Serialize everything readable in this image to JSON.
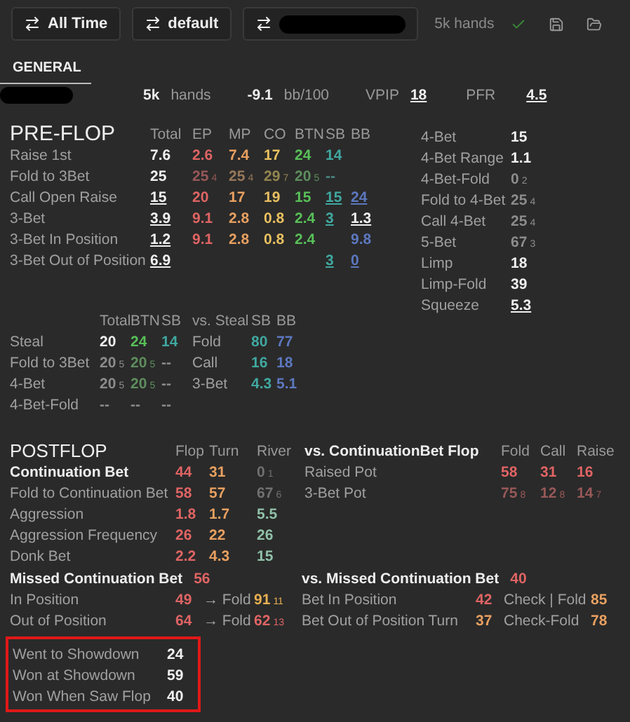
{
  "toolbar": {
    "buttons": [
      {
        "label": "All Time",
        "redacted": false
      },
      {
        "label": "default",
        "redacted": false
      },
      {
        "redacted": true
      }
    ],
    "hands": "5k hands"
  },
  "tabs": [
    {
      "label": "GENERAL",
      "selected": true
    }
  ],
  "summary": {
    "player_redacted": true,
    "items": [
      {
        "value": "5k",
        "unit": "hands"
      },
      {
        "value": "-9.1",
        "unit": "bb/100"
      },
      {
        "unit": "VPIP",
        "value": "18",
        "underlined": true
      },
      {
        "unit": "PFR",
        "value": "4.5",
        "underlined": true
      }
    ]
  },
  "preflop": {
    "title": "PRE-FLOP",
    "columns": [
      "Total",
      "EP",
      "MP",
      "CO",
      "BTN",
      "SB",
      "BB"
    ],
    "rows": [
      {
        "label": "Raise 1st",
        "cells": [
          {
            "v": "7.6",
            "color": "#f0f0f0"
          },
          {
            "v": "2.6",
            "color": "#e06464"
          },
          {
            "v": "7.4",
            "color": "#e8a060"
          },
          {
            "v": "17",
            "color": "#e8c060"
          },
          {
            "v": "24",
            "color": "#58c058"
          },
          {
            "v": "14",
            "color": "#40a8a0"
          },
          null
        ]
      },
      {
        "label": "Fold to 3Bet",
        "cells": [
          {
            "v": "25",
            "color": "#f0f0f0"
          },
          {
            "v": "25",
            "n": "4",
            "color": "#985858"
          },
          {
            "v": "25",
            "n": "4",
            "color": "#98785a"
          },
          {
            "v": "29",
            "n": "7",
            "color": "#948650"
          },
          {
            "v": "20",
            "n": "5",
            "color": "#5e8e5e"
          },
          {
            "v": "--",
            "color": "#4a8a84"
          },
          null
        ]
      },
      {
        "label": "Call Open Raise",
        "cells": [
          {
            "v": "15",
            "color": "#f0f0f0",
            "underlined": true
          },
          {
            "v": "20",
            "color": "#e06464"
          },
          {
            "v": "17",
            "color": "#e8a060"
          },
          {
            "v": "19",
            "color": "#e8c060"
          },
          {
            "v": "15",
            "color": "#58c058"
          },
          {
            "v": "15",
            "color": "#40a8a0",
            "underlined": true
          },
          {
            "v": "24",
            "color": "#5c78c0",
            "underlined": true
          }
        ]
      },
      {
        "label": "3-Bet",
        "cells": [
          {
            "v": "3.9",
            "color": "#f0f0f0",
            "underlined": true
          },
          {
            "v": "9.1",
            "color": "#e06464"
          },
          {
            "v": "2.8",
            "color": "#e8a060"
          },
          {
            "v": "0.8",
            "color": "#e8c060"
          },
          {
            "v": "2.4",
            "color": "#58c058"
          },
          {
            "v": "3",
            "color": "#40a8a0",
            "underlined": true
          },
          {
            "v": "1.3",
            "color": "#f0f0f0",
            "underlined": true
          }
        ]
      },
      {
        "label": "3-Bet In Position",
        "cells": [
          {
            "v": "1.2",
            "color": "#f0f0f0",
            "underlined": true
          },
          {
            "v": "9.1",
            "color": "#e06464"
          },
          {
            "v": "2.8",
            "color": "#e8a060"
          },
          {
            "v": "0.8",
            "color": "#e8c060"
          },
          {
            "v": "2.4",
            "color": "#58c058"
          },
          null,
          {
            "v": "9.8",
            "color": "#5c78c0"
          }
        ]
      },
      {
        "label": "3-Bet Out of Position",
        "cells": [
          {
            "v": "6.9",
            "color": "#f0f0f0",
            "underlined": true
          },
          null,
          null,
          null,
          null,
          {
            "v": "3",
            "color": "#40a8a0",
            "underlined": true
          },
          {
            "v": "0",
            "color": "#5c78c0",
            "underlined": true
          }
        ]
      }
    ],
    "side": [
      {
        "label": "4-Bet",
        "cell": {
          "v": "15",
          "color": "#f0f0f0"
        }
      },
      {
        "label": "4-Bet Range",
        "cell": {
          "v": "1.1",
          "color": "#f0f0f0"
        }
      },
      {
        "label": "4-Bet-Fold",
        "cell": {
          "v": "0",
          "n": "2",
          "color": "#8c8c8c"
        }
      },
      {
        "label": "Fold to 4-Bet",
        "cell": {
          "v": "25",
          "n": "4",
          "color": "#8c8c8c"
        }
      },
      {
        "label": "Call 4-Bet",
        "cell": {
          "v": "25",
          "n": "4",
          "color": "#8c8c8c"
        }
      },
      {
        "label": "5-Bet",
        "cell": {
          "v": "67",
          "n": "3",
          "color": "#8c8c8c"
        }
      },
      {
        "label": "Limp",
        "cell": {
          "v": "18",
          "color": "#f0f0f0"
        }
      },
      {
        "label": "Limp-Fold",
        "cell": {
          "v": "39",
          "color": "#f0f0f0"
        }
      },
      {
        "label": "Squeeze",
        "cell": {
          "v": "5.3",
          "color": "#f0f0f0",
          "underlined": true
        }
      }
    ]
  },
  "steal": {
    "columns": [
      "Total",
      "BTN",
      "SB"
    ],
    "vs_title": "vs. Steal",
    "vs_columns": [
      "SB",
      "BB"
    ],
    "rows": [
      {
        "label": "Steal",
        "cells": [
          {
            "v": "20",
            "color": "#f0f0f0"
          },
          {
            "v": "24",
            "color": "#58c058"
          },
          {
            "v": "14",
            "color": "#40a8a0"
          }
        ],
        "vs_label": "Fold",
        "vs_cells": [
          {
            "v": "80",
            "color": "#40a8a0"
          },
          {
            "v": "77",
            "color": "#5c78c0"
          }
        ]
      },
      {
        "label": "Fold to 3Bet",
        "cells": [
          {
            "v": "20",
            "n": "5",
            "color": "#8c8c8c"
          },
          {
            "v": "20",
            "n": "5",
            "color": "#5e8e5e"
          },
          {
            "v": "--",
            "color": "#8c8c8c"
          }
        ],
        "vs_label": "Call",
        "vs_cells": [
          {
            "v": "16",
            "color": "#40a8a0"
          },
          {
            "v": "18",
            "color": "#5c78c0"
          }
        ]
      },
      {
        "label": "4-Bet",
        "cells": [
          {
            "v": "20",
            "n": "5",
            "color": "#8c8c8c"
          },
          {
            "v": "20",
            "n": "5",
            "color": "#5e8e5e"
          },
          {
            "v": "--",
            "color": "#8c8c8c"
          }
        ],
        "vs_label": "3-Bet",
        "vs_cells": [
          {
            "v": "4.3",
            "color": "#40a8a0"
          },
          {
            "v": "5.1",
            "color": "#5c78c0"
          }
        ]
      },
      {
        "label": "4-Bet-Fold",
        "cells": [
          {
            "v": "--",
            "color": "#8c8c8c"
          },
          {
            "v": "--",
            "color": "#8c8c8c"
          },
          {
            "v": "--",
            "color": "#8c8c8c"
          }
        ]
      }
    ]
  },
  "postflop": {
    "title": "POSTFLOP",
    "columns": [
      "Flop",
      "Turn",
      "River"
    ],
    "rows": [
      {
        "label": "Continuation Bet",
        "emphasis": true,
        "cells": [
          {
            "v": "44",
            "color": "#e06464"
          },
          {
            "v": "31",
            "color": "#e8a060"
          },
          {
            "v": "0",
            "n": "1",
            "color": "#707070"
          }
        ]
      },
      {
        "label": "Fold to Continuation Bet",
        "emphasis": false,
        "cells": [
          {
            "v": "58",
            "color": "#e06464"
          },
          {
            "v": "57",
            "color": "#e8a060"
          },
          {
            "v": "67",
            "n": "6",
            "color": "#707070"
          }
        ]
      },
      {
        "label": "Aggression",
        "emphasis": false,
        "cells": [
          {
            "v": "1.8",
            "color": "#e06464"
          },
          {
            "v": "1.7",
            "color": "#e8a060"
          },
          {
            "v": "5.5",
            "color": "#90c0a8"
          }
        ]
      },
      {
        "label": "Aggression Frequency",
        "emphasis": false,
        "cells": [
          {
            "v": "26",
            "color": "#e06464"
          },
          {
            "v": "22",
            "color": "#e8a060"
          },
          {
            "v": "26",
            "color": "#90c0a8"
          }
        ]
      },
      {
        "label": "Donk Bet",
        "emphasis": false,
        "cells": [
          {
            "v": "2.2",
            "color": "#e06464"
          },
          {
            "v": "4.3",
            "color": "#e8a060"
          },
          {
            "v": "15",
            "color": "#90c0a8"
          }
        ]
      }
    ],
    "vs_cbet": {
      "title": "vs. ContinuationBet Flop",
      "columns": [
        "Fold",
        "Call",
        "Raise"
      ],
      "rows": [
        {
          "label": "Raised Pot",
          "cells": [
            {
              "v": "58",
              "color": "#e06464"
            },
            {
              "v": "31",
              "color": "#e06464"
            },
            {
              "v": "16",
              "color": "#e06464"
            }
          ]
        },
        {
          "label": "3-Bet Pot",
          "cells": [
            {
              "v": "75",
              "n": "8",
              "color": "#985858"
            },
            {
              "v": "12",
              "n": "8",
              "color": "#985858"
            },
            {
              "v": "14",
              "n": "7",
              "color": "#985858"
            }
          ]
        }
      ]
    },
    "missed": {
      "title": "Missed Continuation Bet",
      "cell": {
        "v": "56",
        "color": "#e06464"
      },
      "rows": [
        {
          "label": "In Position",
          "cell": {
            "v": "49",
            "color": "#e06464"
          },
          "arrow": "→ Fold",
          "then": {
            "v": "91",
            "n": "11",
            "color": "#e8b050"
          }
        },
        {
          "label": "Out of Position",
          "cell": {
            "v": "64",
            "color": "#e06464"
          },
          "arrow": "→ Fold",
          "then": {
            "v": "62",
            "n": "13",
            "color": "#e06464"
          }
        }
      ]
    },
    "vs_missed": {
      "title": "vs. Missed Continuation Bet",
      "cell": {
        "v": "40",
        "color": "#e06464"
      },
      "rows": [
        {
          "label": "Bet In Position",
          "cell": {
            "v": "42",
            "color": "#e06464"
          },
          "next": "Check | Fold",
          "then": {
            "v": "85",
            "color": "#e8a060"
          }
        },
        {
          "label": "Bet Out of Position Turn",
          "cell": {
            "v": "37",
            "color": "#e8a060"
          },
          "next": "Check-Fold",
          "then": {
            "v": "78",
            "color": "#e8a060"
          }
        }
      ]
    },
    "showdown": {
      "highlighted": true,
      "rows": [
        {
          "label": "Went to Showdown",
          "cell": {
            "v": "24",
            "color": "#f0f0f0"
          }
        },
        {
          "label": "Won at Showdown",
          "cell": {
            "v": "59",
            "color": "#f0f0f0"
          }
        },
        {
          "label": "Won When Saw Flop",
          "cell": {
            "v": "40",
            "color": "#f0f0f0"
          }
        }
      ]
    }
  }
}
